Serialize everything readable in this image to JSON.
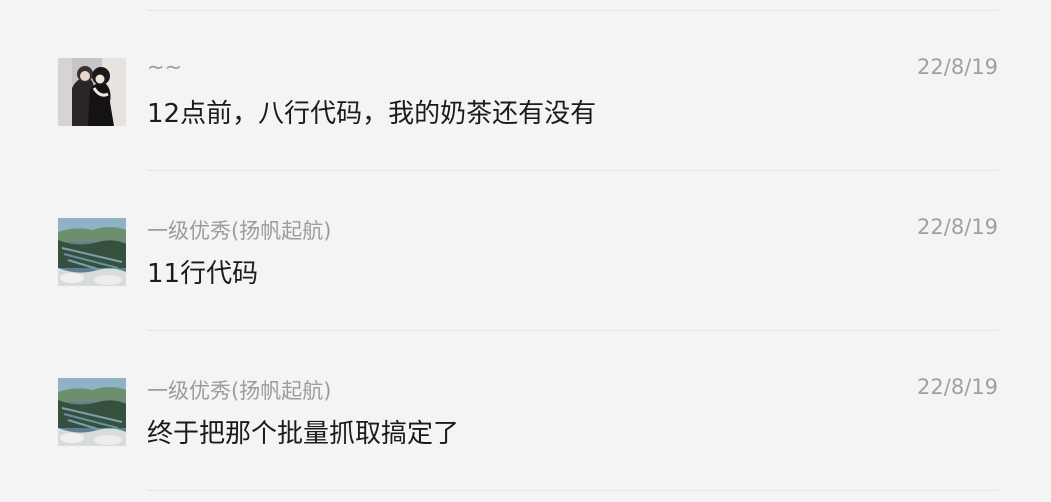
{
  "messages": [
    {
      "sender": "~~",
      "date": "22/8/19",
      "text": "12点前，八行代码，我的奶茶还有没有",
      "avatar_icon": "couple-photo"
    },
    {
      "sender": "一级优秀(扬帆起航)",
      "date": "22/8/19",
      "text": "11行代码",
      "avatar_icon": "landscape-photo"
    },
    {
      "sender": "一级优秀(扬帆起航)",
      "date": "22/8/19",
      "text": "终于把那个批量抓取搞定了",
      "avatar_icon": "landscape-photo"
    }
  ]
}
